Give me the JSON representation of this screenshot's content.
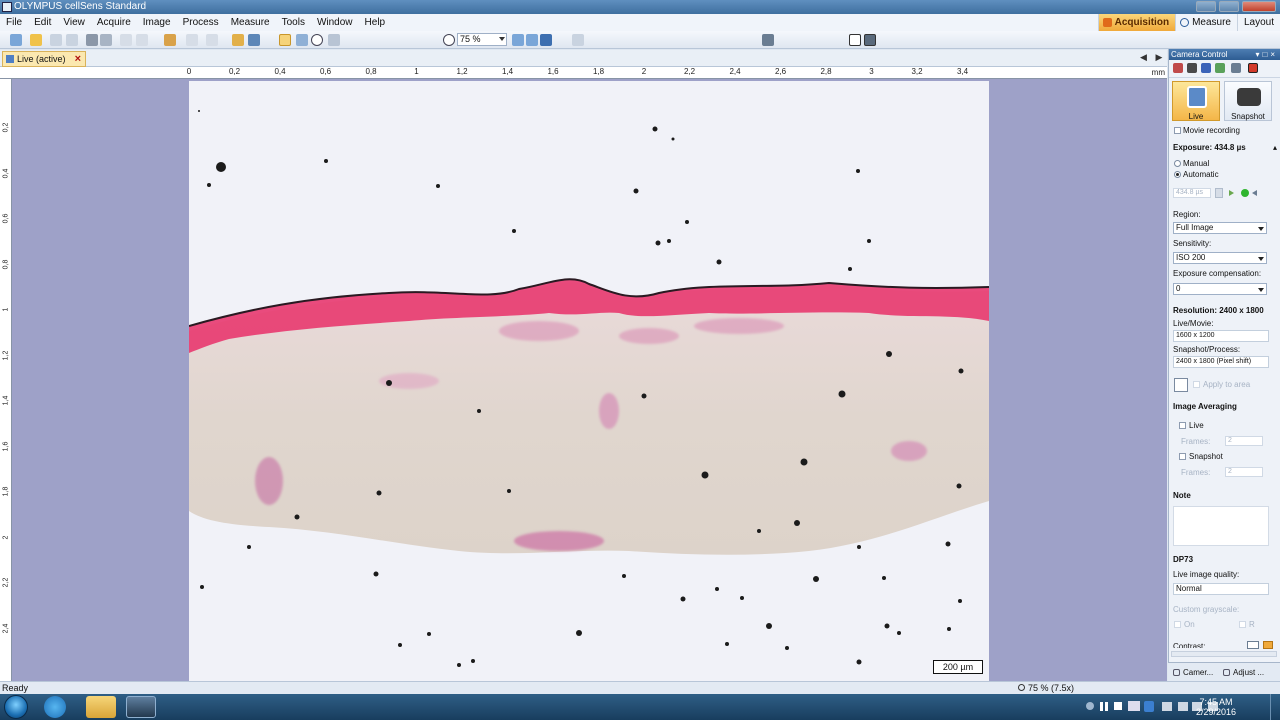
{
  "window": {
    "title": "OLYMPUS cellSens Standard"
  },
  "menu": [
    "File",
    "Edit",
    "View",
    "Acquire",
    "Image",
    "Process",
    "Measure",
    "Tools",
    "Window",
    "Help"
  ],
  "layout_tabs": [
    {
      "label": "Acquisition",
      "active": true
    },
    {
      "label": "Measure",
      "active": false
    },
    {
      "label": "Layout",
      "active": false
    }
  ],
  "toolbar": {
    "zoom_value": "75 %"
  },
  "document": {
    "tab_label": "Live (active)"
  },
  "ruler": {
    "unit": "mm",
    "h_ticks": [
      "0",
      "0,2",
      "0,4",
      "0,6",
      "0,8",
      "1",
      "1,2",
      "1,4",
      "1,6",
      "1,8",
      "2",
      "2,2",
      "2,4",
      "2,6",
      "2,8",
      "3",
      "3,2",
      "3,4"
    ],
    "v_ticks": [
      "0,2",
      "0,4",
      "0,6",
      "0,8",
      "1",
      "1,2",
      "1,4",
      "1,6",
      "1,8",
      "2",
      "2,2",
      "2,4"
    ]
  },
  "image": {
    "scale_bar_label": "200 µm"
  },
  "status": {
    "text": "Ready",
    "zoom": "75 % (7.5x)"
  },
  "panel": {
    "title": "Camera Control",
    "live_label": "Live",
    "snapshot_label": "Snapshot",
    "movie_recording_label": "Movie recording",
    "exposure_heading": "Exposure: 434.8 µs",
    "manual_label": "Manual",
    "automatic_label": "Automatic",
    "automatic_selected": true,
    "exposure_field": "434.8 µs",
    "region_label": "Region:",
    "region_value": "Full Image",
    "sensitivity_label": "Sensitivity:",
    "sensitivity_value": "ISO 200",
    "exposure_comp_label": "Exposure compensation:",
    "exposure_comp_value": "0",
    "resolution_heading": "Resolution: 2400 x 1800",
    "live_movie_label": "Live/Movie:",
    "live_movie_value": "1600 x 1200",
    "snapshot_process_label": "Snapshot/Process:",
    "snapshot_process_value": "2400 x 1800 (Pixel shift)",
    "apply_roi_label": "Apply to area",
    "image_averaging_heading": "Image Averaging",
    "avg_live_label": "Live",
    "avg_snapshot_label": "Snapshot",
    "frames_label": "Frames:",
    "frames_live_value": "2",
    "frames_snapshot_value": "2",
    "note_heading": "Note",
    "camera_model": "DP73",
    "live_quality_label": "Live image quality:",
    "live_quality_value": "Normal",
    "custom_grayscale_label": "Custom grayscale:",
    "on_label": "On",
    "r_label": "R",
    "contrast_label": "Contrast:",
    "bottom_tabs": [
      "Camer...",
      "Adjust ..."
    ]
  },
  "taskbar": {
    "time": "7:45 AM",
    "date": "2/29/2016"
  },
  "colors": {
    "accent_orange": "#f4b648",
    "stain_pink": "#e8386f",
    "workspace": "#9ea1c8"
  }
}
